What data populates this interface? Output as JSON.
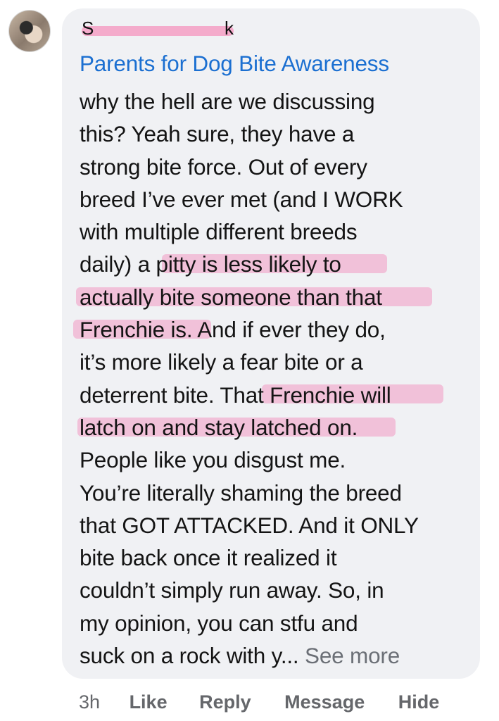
{
  "comment": {
    "author_fragments": [
      "S",
      "k"
    ],
    "page_link": "Parents for Dog Bite Awareness",
    "lines": [
      "why the hell are we discussing",
      "this? Yeah sure, they have a",
      "strong bite force. Out of every",
      "breed I’ve ever met (and I WORK",
      "with multiple different breeds",
      "daily) a pitty is less likely to",
      "actually bite someone than that",
      "Frenchie is. And if ever they do,",
      "it’s more likely a fear bite or a",
      "deterrent bite. That Frenchie will",
      "latch on and stay latched on.",
      "People like you disgust me.",
      "You’re literally shaming the breed",
      "that GOT ATTACKED. And it ONLY",
      "bite back once it realized it",
      "couldn’t simply run away. So, in",
      "my opinion, you can stfu and",
      "suck on a rock with y..."
    ],
    "see_more": "See more"
  },
  "actions": {
    "time": "3h",
    "like": "Like",
    "reply": "Reply",
    "message": "Message",
    "hide": "Hide"
  },
  "colors": {
    "bubble": "#f0f1f4",
    "link": "#1b6fd1",
    "highlight": "#f1b9d3",
    "redaction": "#f3a6c8",
    "muted": "#65676b"
  }
}
